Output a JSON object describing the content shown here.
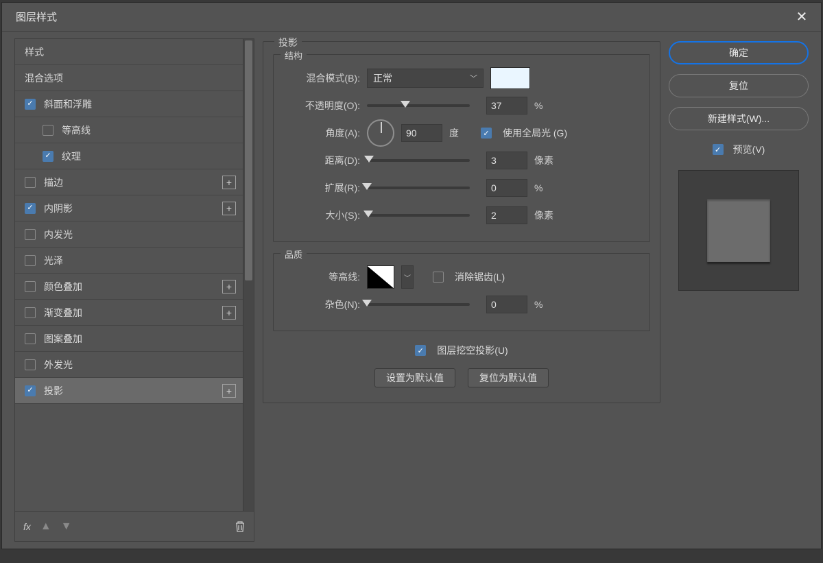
{
  "title": "图层样式",
  "sidebar": {
    "header": "样式",
    "blend_options": "混合选项",
    "items": [
      {
        "label": "斜面和浮雕",
        "checked": true,
        "indent": false,
        "hasPlus": false
      },
      {
        "label": "等高线",
        "checked": false,
        "indent": true,
        "hasPlus": false
      },
      {
        "label": "纹理",
        "checked": true,
        "indent": true,
        "hasPlus": false
      },
      {
        "label": "描边",
        "checked": false,
        "indent": false,
        "hasPlus": true
      },
      {
        "label": "内阴影",
        "checked": true,
        "indent": false,
        "hasPlus": true
      },
      {
        "label": "内发光",
        "checked": false,
        "indent": false,
        "hasPlus": false
      },
      {
        "label": "光泽",
        "checked": false,
        "indent": false,
        "hasPlus": false
      },
      {
        "label": "颜色叠加",
        "checked": false,
        "indent": false,
        "hasPlus": true
      },
      {
        "label": "渐变叠加",
        "checked": false,
        "indent": false,
        "hasPlus": true
      },
      {
        "label": "图案叠加",
        "checked": false,
        "indent": false,
        "hasPlus": false
      },
      {
        "label": "外发光",
        "checked": false,
        "indent": false,
        "hasPlus": false
      },
      {
        "label": "投影",
        "checked": true,
        "indent": false,
        "hasPlus": true,
        "selected": true
      }
    ],
    "fx": "fx"
  },
  "main": {
    "section_title": "投影",
    "structure": {
      "legend": "结构",
      "blend_mode_label": "混合模式(B):",
      "blend_mode_value": "正常",
      "opacity_label": "不透明度(O):",
      "opacity_value": "37",
      "opacity_unit": "%",
      "angle_label": "角度(A):",
      "angle_value": "90",
      "angle_unit": "度",
      "global_light_label": "使用全局光 (G)",
      "global_light_checked": true,
      "distance_label": "距离(D):",
      "distance_value": "3",
      "distance_unit": "像素",
      "spread_label": "扩展(R):",
      "spread_value": "0",
      "spread_unit": "%",
      "size_label": "大小(S):",
      "size_value": "2",
      "size_unit": "像素"
    },
    "quality": {
      "legend": "品质",
      "contour_label": "等高线:",
      "antialias_label": "消除锯齿(L)",
      "antialias_checked": false,
      "noise_label": "杂色(N):",
      "noise_value": "0",
      "noise_unit": "%"
    },
    "knockout_label": "图层挖空投影(U)",
    "knockout_checked": true,
    "btn_default": "设置为默认值",
    "btn_reset": "复位为默认值"
  },
  "right": {
    "ok": "确定",
    "cancel": "复位",
    "new_style": "新建样式(W)...",
    "preview_label": "预览(V)",
    "preview_checked": true
  }
}
